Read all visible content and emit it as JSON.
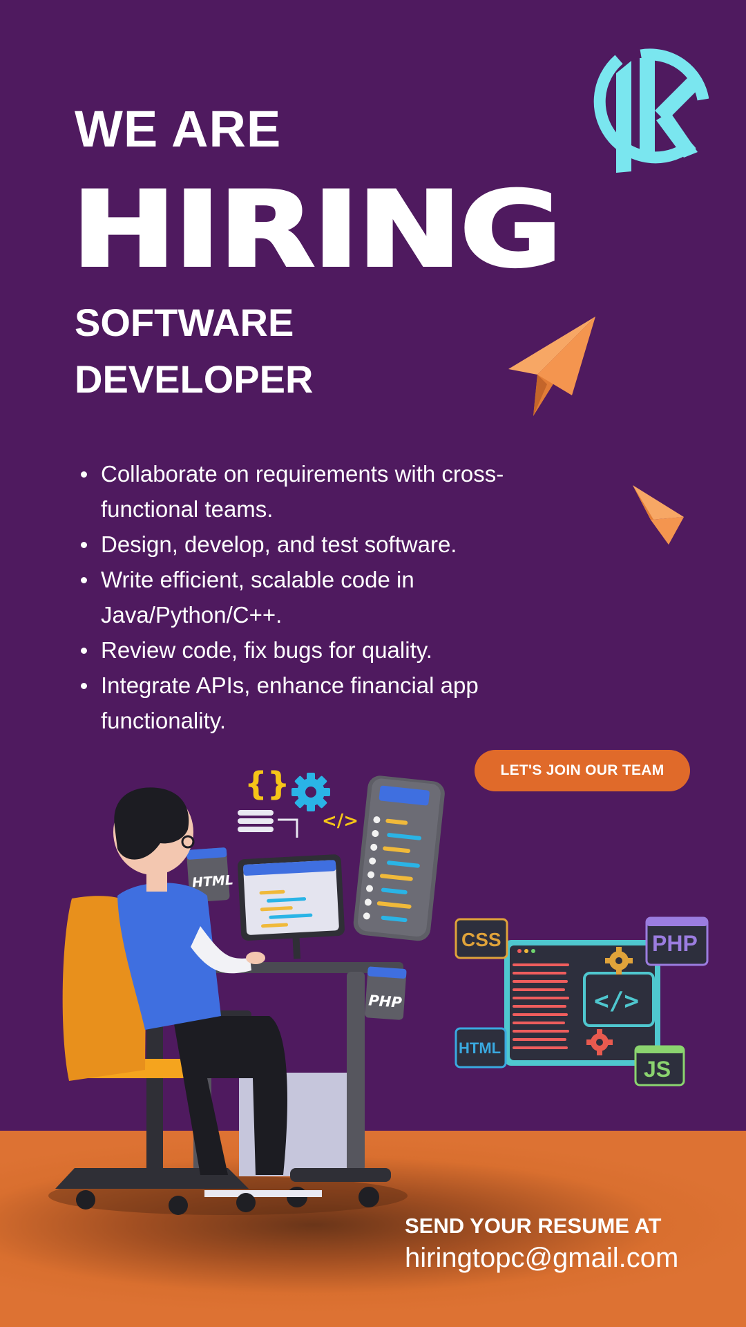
{
  "header": {
    "line1": "WE ARE",
    "line2": "HIRING",
    "role_line1": "SOFTWARE",
    "role_line2": "DEVELOPER"
  },
  "duties": [
    "Collaborate on requirements with cross-functional teams.",
    "Design, develop, and test software.",
    "Write efficient, scalable code in Java/Python/C++.",
    "Review code, fix bugs for quality.",
    "Integrate APIs, enhance financial app functionality."
  ],
  "cta": {
    "label": "LET'S JOIN OUR TEAM"
  },
  "contact": {
    "label": "SEND YOUR RESUME AT",
    "email": "hiringtopc@gmail.com"
  },
  "illustration": {
    "monitor_tag": "HTML",
    "desk_tag": "PHP",
    "panel_tags": [
      "CSS",
      "PHP",
      "HTML",
      "JS"
    ],
    "code_symbol": "</>",
    "brace_symbol": "{}"
  },
  "colors": {
    "background": "#4f1a5f",
    "floor": "#dd7233",
    "accent": "#e06a2a",
    "logo": "#7ae6ef",
    "plane": "#f4954f"
  },
  "icons": [
    "k-logo-icon",
    "paper-plane-icon",
    "gear-icon",
    "code-icon",
    "chair-icon"
  ]
}
